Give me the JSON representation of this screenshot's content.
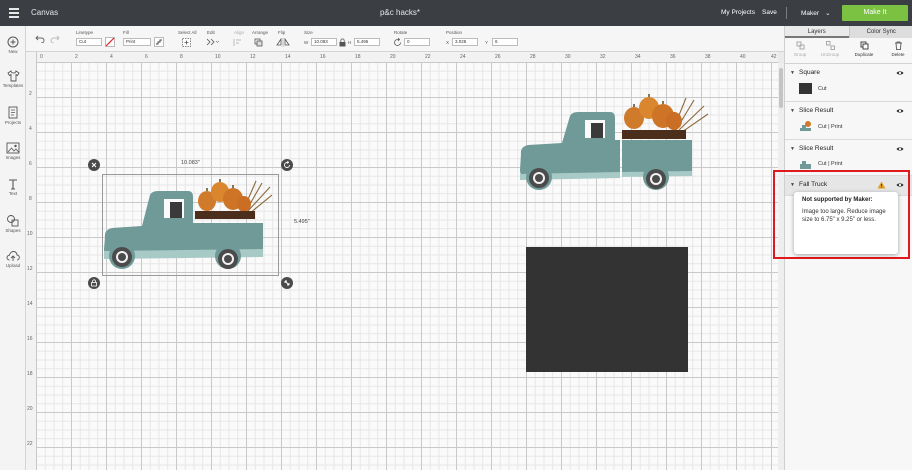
{
  "topbar": {
    "app_title": "Canvas",
    "project_name": "p&c hacks*",
    "my_projects": "My Projects",
    "save": "Save",
    "machine": "Maker",
    "make_it": "Make It"
  },
  "leftbar": {
    "items": [
      {
        "label": "New",
        "icon": "plus-circle-icon"
      },
      {
        "label": "Templates",
        "icon": "tshirt-icon"
      },
      {
        "label": "Projects",
        "icon": "projects-icon"
      },
      {
        "label": "Images",
        "icon": "image-icon"
      },
      {
        "label": "Text",
        "icon": "text-icon"
      },
      {
        "label": "Shapes",
        "icon": "shapes-icon"
      },
      {
        "label": "Upload",
        "icon": "upload-icon"
      }
    ]
  },
  "toolbar": {
    "linetype_label": "Linetype",
    "linetype_value": "Cut",
    "fill_label": "Fill",
    "fill_value": "Print",
    "select_all_label": "Select All",
    "edit_label": "Edit",
    "align_label": "Align",
    "arrange_label": "Arrange",
    "flip_label": "Flip",
    "size_label": "Size",
    "width_prefix": "W",
    "width_value": "10.083",
    "height_prefix": "H",
    "height_value": "5.495",
    "rotate_label": "Rotate",
    "rotate_value": "0",
    "position_label": "Position",
    "x_prefix": "X",
    "x_value": "3.028",
    "y_prefix": "Y",
    "y_value": "6"
  },
  "rulers": {
    "horizontal": [
      "0",
      "2",
      "4",
      "6",
      "8",
      "10",
      "12",
      "14",
      "16",
      "18",
      "20",
      "22",
      "24",
      "26",
      "28",
      "30",
      "32",
      "34",
      "36",
      "38",
      "40",
      "42"
    ],
    "vertical": [
      "2",
      "4",
      "6",
      "8",
      "10",
      "12",
      "14",
      "16",
      "18",
      "20",
      "22"
    ]
  },
  "canvas": {
    "selection_width": "10.083\"",
    "selection_height": "5.495\""
  },
  "panel": {
    "tabs": [
      "Layers",
      "Color Sync"
    ],
    "actions": [
      "Group",
      "UnGroup",
      "Duplicate",
      "Delete"
    ],
    "layers": [
      {
        "name": "Square",
        "op": "Cut"
      },
      {
        "name": "Slice Result",
        "op": "Cut | Print"
      },
      {
        "name": "Slice Result",
        "op": "Cut | Print"
      },
      {
        "name": "Fall Truck",
        "op": ""
      }
    ],
    "tooltip_title": "Not supported by Maker:",
    "tooltip_body": "Image too large. Reduce image size to 6.75\" x 9.25\" or less."
  },
  "colors": {
    "topbar": "#3b3f44",
    "make_it": "#7cc242",
    "truck": "#6f9a98",
    "pumpkin": "#d07a2c",
    "square": "#333333",
    "highlight": "#e0191e"
  }
}
